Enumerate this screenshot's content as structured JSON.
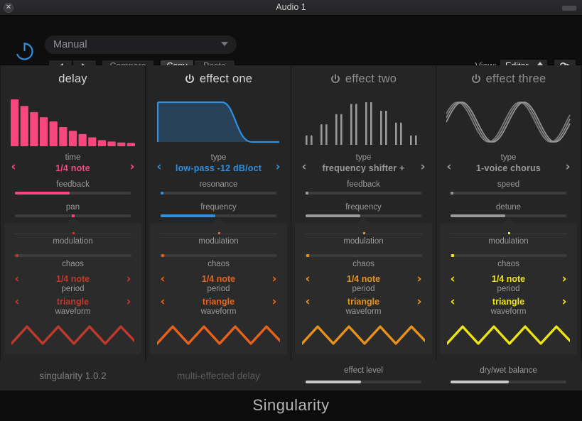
{
  "window": {
    "title": "Audio 1",
    "close_icon": "close-icon",
    "resize_icon": "resize-handle"
  },
  "header": {
    "power_icon": "power-icon",
    "preset": {
      "value": "Manual",
      "placeholder": "Manual",
      "dropdown_icon": "chevron-down-icon"
    },
    "prev_icon": "triangle-left-icon",
    "next_icon": "triangle-right-icon",
    "compare_label": "Compare",
    "copy_label": "Copy",
    "paste_label": "Paste",
    "view_label": "View:",
    "view_value": "Editor",
    "view_stepper_icon": "stepper-updown-icon",
    "link_icon": "link-icon"
  },
  "colors": {
    "delay": "#f8477f",
    "effect_one": "#2f8fe0",
    "effect_two": "#8f8f8f",
    "effect_three": "#9a9a9a",
    "mod_delay": "#c0392b",
    "mod_one": "#e8621a",
    "mod_two": "#e8921a",
    "mod_three": "#ede513",
    "panel_bg": "#252525",
    "mod_bg": "#2b2b2b",
    "track": "#3c3c3c"
  },
  "columns": [
    {
      "title": "delay",
      "has_power": false,
      "power_icon": "",
      "enabled": true,
      "accent": "#f8477f",
      "viz": {
        "type": "bar",
        "name": "delay-taps-graph",
        "values": [
          100,
          86,
          73,
          62,
          53,
          41,
          33,
          26,
          19,
          13,
          10,
          8,
          7
        ]
      },
      "selector": {
        "caption": "time",
        "value": "1/4 note",
        "prev_icon": "chevron-left-icon",
        "next_icon": "chevron-right-icon"
      },
      "sliders": [
        {
          "caption": "feedback",
          "value": 47,
          "style": "fill"
        },
        {
          "caption": "pan",
          "value": 50,
          "style": "dot"
        }
      ],
      "modulation": {
        "title": "modulation",
        "accent": "#c0392b",
        "amount": 2,
        "chaos_caption": "chaos",
        "period": {
          "value": "1/4 note",
          "caption": "period"
        },
        "waveform": {
          "value": "triangle",
          "caption": "waveform"
        },
        "wave_shape": "triangle"
      }
    },
    {
      "title": "effect one",
      "has_power": true,
      "power_icon": "power-icon",
      "enabled": true,
      "accent": "#2f8fe0",
      "viz": {
        "type": "filter-curve",
        "name": "lowpass-curve-graph",
        "cutoff": 0.62
      },
      "selector": {
        "caption": "type",
        "value": "low-pass -12 dB/oct",
        "prev_icon": "chevron-left-icon",
        "next_icon": "chevron-right-icon"
      },
      "sliders": [
        {
          "caption": "resonance",
          "value": 1,
          "style": "dot"
        },
        {
          "caption": "frequency",
          "value": 47,
          "style": "fill"
        }
      ],
      "modulation": {
        "title": "modulation",
        "accent": "#e8621a",
        "amount": 2,
        "chaos_caption": "chaos",
        "period": {
          "value": "1/4 note",
          "caption": "period"
        },
        "waveform": {
          "value": "triangle",
          "caption": "waveform"
        },
        "wave_shape": "triangle"
      }
    },
    {
      "title": "effect two",
      "has_power": true,
      "power_icon": "power-icon",
      "enabled": false,
      "accent": "#9a9a9a",
      "viz": {
        "type": "spectrum-pairs",
        "name": "frequency-shifter-graph",
        "values": [
          22,
          22,
          48,
          48,
          72,
          72,
          96,
          96,
          100,
          100,
          80,
          80,
          52,
          52,
          22,
          22
        ]
      },
      "selector": {
        "caption": "type",
        "value": "frequency shifter +",
        "prev_icon": "chevron-left-icon",
        "next_icon": "chevron-right-icon"
      },
      "sliders": [
        {
          "caption": "feedback",
          "value": 1,
          "style": "dot"
        },
        {
          "caption": "frequency",
          "value": 47,
          "style": "fill"
        }
      ],
      "modulation": {
        "title": "modulation",
        "accent": "#e8921a",
        "amount": 2,
        "chaos_caption": "chaos",
        "period": {
          "value": "1/4 note",
          "caption": "period"
        },
        "waveform": {
          "value": "triangle",
          "caption": "waveform"
        },
        "wave_shape": "triangle"
      }
    },
    {
      "title": "effect three",
      "has_power": true,
      "power_icon": "power-icon",
      "enabled": false,
      "accent": "#9a9a9a",
      "viz": {
        "type": "multi-sine",
        "name": "chorus-voices-graph",
        "voices": 3,
        "cycles": 2
      },
      "selector": {
        "caption": "type",
        "value": "1-voice chorus",
        "prev_icon": "chevron-left-icon",
        "next_icon": "chevron-right-icon"
      },
      "sliders": [
        {
          "caption": "speed",
          "value": 1,
          "style": "dot"
        },
        {
          "caption": "detune",
          "value": 47,
          "style": "fill"
        }
      ],
      "modulation": {
        "title": "modulation",
        "accent": "#ede513",
        "amount": 2,
        "chaos_caption": "chaos",
        "period": {
          "value": "1/4 note",
          "caption": "period"
        },
        "waveform": {
          "value": "triangle",
          "caption": "waveform"
        },
        "wave_shape": "triangle"
      }
    }
  ],
  "footer": {
    "version": "singularity 1.0.2",
    "subtitle": "multi-effected delay",
    "effect_level": {
      "caption": "effect level",
      "value": 48
    },
    "dry_wet": {
      "caption": "dry/wet balance",
      "value": 50
    }
  },
  "brand": {
    "name": "Singularity"
  }
}
